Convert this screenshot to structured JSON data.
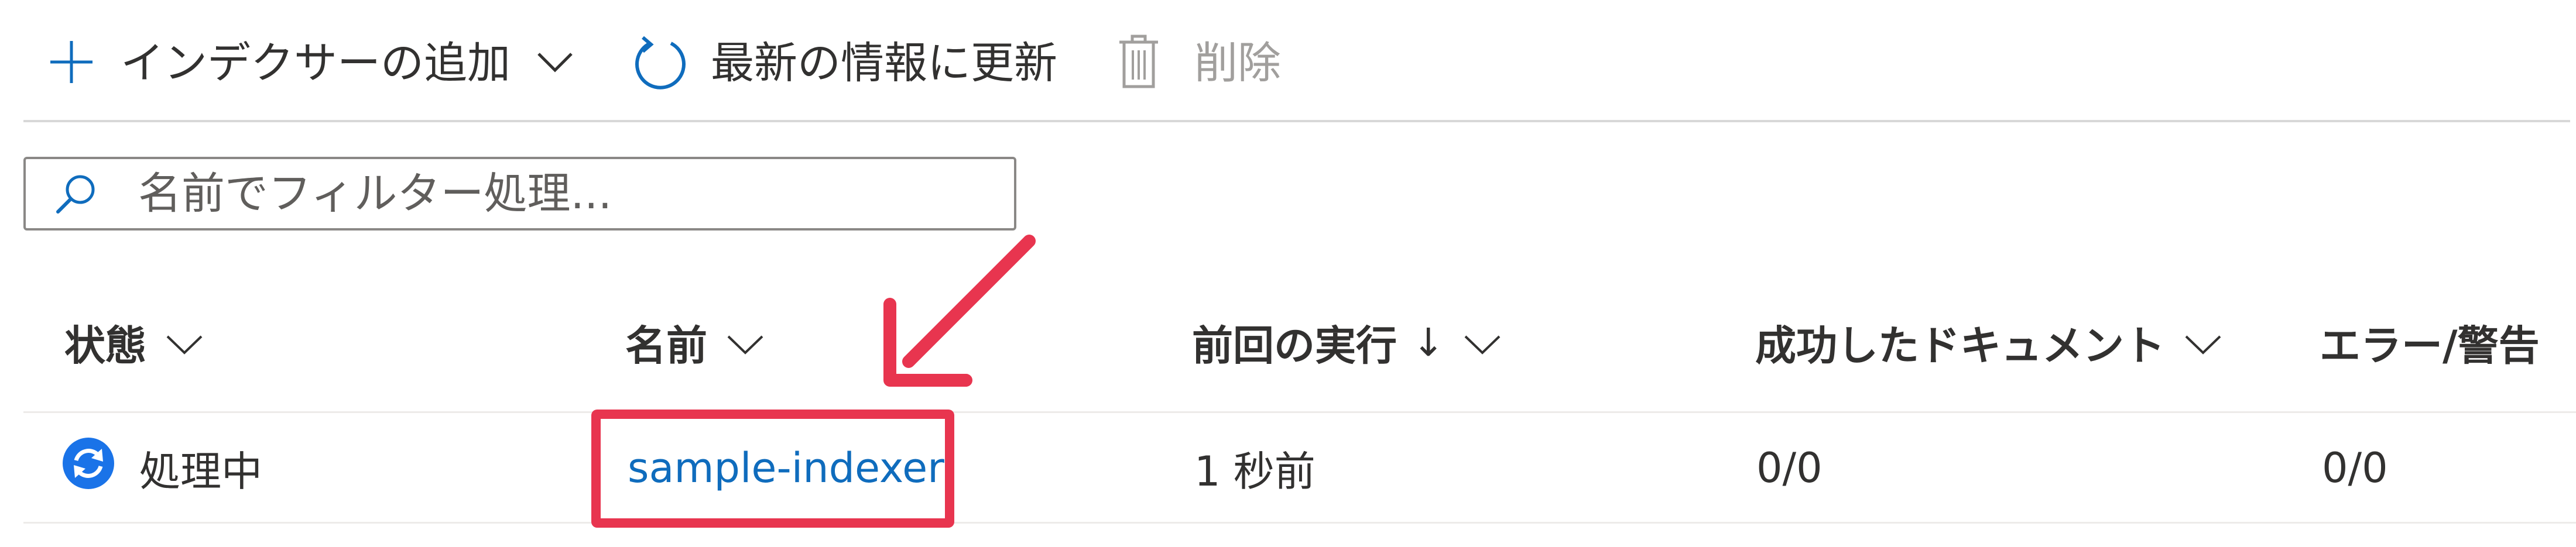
{
  "toolbar": {
    "add_indexer_label": "インデクサーの追加",
    "refresh_label": "最新の情報に更新",
    "delete_label": "削除"
  },
  "search": {
    "placeholder": "名前でフィルター処理..."
  },
  "table": {
    "columns": {
      "status": "状態",
      "name": "名前",
      "last_run": "前回の実行",
      "last_run_sort": "↓",
      "succeeded_docs": "成功したドキュメント",
      "errors_warnings": "エラー/警告"
    },
    "rows": [
      {
        "status": "処理中",
        "name": "sample-indexer",
        "last_run": "1 秒前",
        "succeeded_docs": "0/0",
        "errors_warnings": "0/0"
      }
    ]
  },
  "colors": {
    "accent": "#0f6cbd",
    "annotation": "#e8354f",
    "status_icon": "#1a73e8"
  },
  "icons": {
    "add": "plus-icon",
    "refresh": "refresh-icon",
    "delete": "trash-icon",
    "search": "search-icon",
    "status": "sync-processing-icon",
    "sort": "chevron-down-icon"
  }
}
